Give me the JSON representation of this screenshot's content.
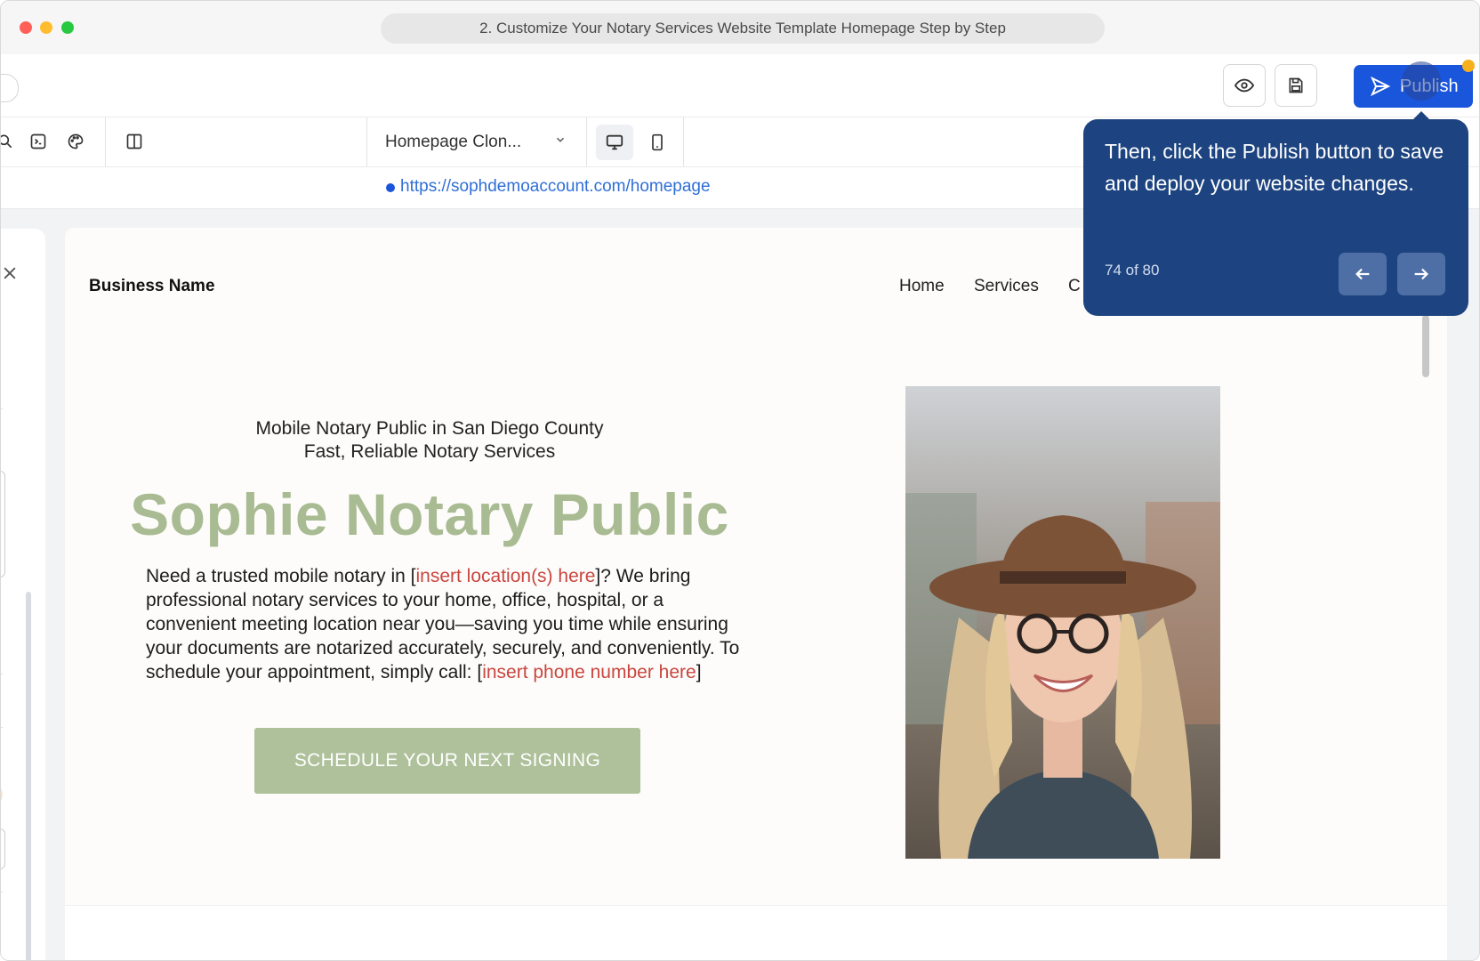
{
  "window": {
    "title": "2. Customize Your Notary Services Website Template Homepage Step by Step"
  },
  "toolbar": {
    "preview_icon": "eye-icon",
    "save_icon": "save-icon",
    "publish_label": "Publish",
    "publish_color": "#1a56db"
  },
  "subbar": {
    "page_select_value": "Homepage Clon...",
    "device_desktop_icon": "desktop-icon",
    "device_mobile_icon": "mobile-icon"
  },
  "url": {
    "value": "https://sophdemoaccount.com/homepage"
  },
  "site": {
    "business_name": "Business Name",
    "nav": [
      "Home",
      "Services",
      "C"
    ],
    "hero_line1": "Mobile Notary Public in San Diego County",
    "hero_line2": "Fast, Reliable Notary Services",
    "hero_title": "Sophie Notary Public",
    "body_part1": "Need a trusted mobile notary in [",
    "body_red1": "insert location(s) here",
    "body_part2": "]? We bring professional notary services to your home, office, hospital, or a convenient meeting location near you—saving you time while ensuring your documents are notarized accurately, securely, and conveniently. To schedule your appointment, simply call: [",
    "body_red2": "insert phone number here",
    "body_part3": "]",
    "cta_label": "SCHEDULE YOUR NEXT SIGNING",
    "accent_color": "#a9bb92",
    "placeholder_color": "#c9463f"
  },
  "tooltip": {
    "text": "Then, click the Publish button to save and deploy your website changes.",
    "step": "74 of 80",
    "bg_color": "#1d4480"
  }
}
